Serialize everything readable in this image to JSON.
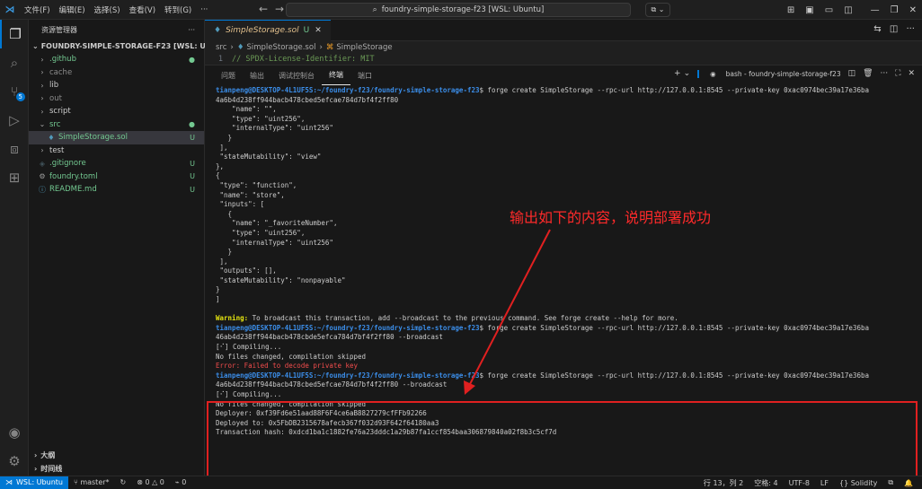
{
  "titlebar": {
    "menus": [
      "文件(F)",
      "编辑(E)",
      "选择(S)",
      "查看(V)",
      "转到(G)",
      "···"
    ],
    "search": "foundry-simple-storage-f23 [WSL: Ubuntu]"
  },
  "sidebar": {
    "title": "资源管理器",
    "root": "FOUNDRY-SIMPLE-STORAGE-F23 [WSL: UBUNTU]",
    "items": [
      {
        "name": ".github",
        "status": "●"
      },
      {
        "name": "cache",
        "status": ""
      },
      {
        "name": "lib",
        "status": ""
      },
      {
        "name": "out",
        "status": ""
      },
      {
        "name": "script",
        "status": ""
      },
      {
        "name": "src",
        "status": "●"
      },
      {
        "name": "SimpleStorage.sol",
        "status": "U"
      },
      {
        "name": "test",
        "status": ""
      },
      {
        "name": ".gitignore",
        "status": "U"
      },
      {
        "name": "foundry.toml",
        "status": "U"
      },
      {
        "name": "README.md",
        "status": "U"
      }
    ],
    "outline": "大纲",
    "timeline": "时间线"
  },
  "editor": {
    "tab_label": "SimpleStorage.sol",
    "tab_status": "U",
    "breadcrumb": [
      "src",
      "SimpleStorage.sol",
      "SimpleStorage"
    ],
    "code_line_no": "1",
    "code_line": "// SPDX-License-Identifier: MIT"
  },
  "panel": {
    "tabs": [
      "问题",
      "输出",
      "调试控制台",
      "终端",
      "端口"
    ],
    "terminal_name": "bash - foundry-simple-storage-f23",
    "user": "tianpeng@DESKTOP-4L1UF5S",
    "path": ":~/foundry-f23/foundry-simple-storage-f23",
    "cmd1a": "$ forge create SimpleStorage --rpc-url http://127.0.0.1:8545 --private-key 0xac0974bec39a17e36ba",
    "cmd1b": "4a6b4d238ff944bacb478cbed5efcae784d7bf4f2ff80",
    "lines": [
      "    \"name\": \"\",",
      "    \"type\": \"uint256\",",
      "    \"internalType\": \"uint256\"",
      "   }",
      " ],",
      " \"stateMutability\": \"view\"",
      "},",
      "{",
      " \"type\": \"function\",",
      " \"name\": \"store\",",
      " \"inputs\": [",
      "   {",
      "    \"name\": \"_favoriteNumber\",",
      "    \"type\": \"uint256\",",
      "    \"internalType\": \"uint256\"",
      "   }",
      " ],",
      " \"outputs\": [],",
      " \"stateMutability\": \"nonpayable\"",
      "}",
      "]"
    ],
    "warning_label": "Warning:",
    "warning_text": " To broadcast this transaction, add --broadcast to the previous command. See forge create --help for more.",
    "cmd2a": "$ forge create SimpleStorage --rpc-url http://127.0.0.1:8545 --private-key 0xac0974bec39a17e36ba",
    "cmd2b": "46ab4d238ff944bacb478cbde5efca784d7bf4f2ff80 --broadcast",
    "compiling1": "[⠊] Compiling...",
    "nochange1": "No files changed, compilation skipped",
    "error_text": "Error: Failed to decode private key",
    "cmd3a": "$ forge create SimpleStorage --rpc-url http://127.0.0.1:8545 --private-key 0xac0974bec39a17e36ba",
    "cmd3b": "4a6b4d238ff944bacb478cbed5efcae784d7bf4f2ff80 --broadcast",
    "compiling2": "[⠊] Compiling...",
    "nochange2": "No files changed, compilation skipped",
    "deployer": "Deployer: 0xf39Fd6e51aad88F6F4ce6aB8827279cfFFb92266",
    "deployed": "Deployed to: 0x5FbDB2315678afecb367f032d93F642f64180aa3",
    "txhash": "Transaction hash: 0xdcd1ba1c1882fe76a23dddc1a29b87fa1ccf854baa306879840a02f8b3c5cf7d"
  },
  "annotation": "输出如下的内容，说明部署成功",
  "statusbar": {
    "remote": "WSL: Ubuntu",
    "branch": "master*",
    "problems": "⊗ 0 △ 0",
    "ports": "0",
    "cursor": "行 13，列 2",
    "spaces": "空格: 4",
    "encoding": "UTF-8",
    "eol": "LF",
    "language": "Solidity"
  },
  "colors": {
    "accent": "#0078d4",
    "highlight": "#e02020",
    "annotation": "#ff2a2a"
  }
}
